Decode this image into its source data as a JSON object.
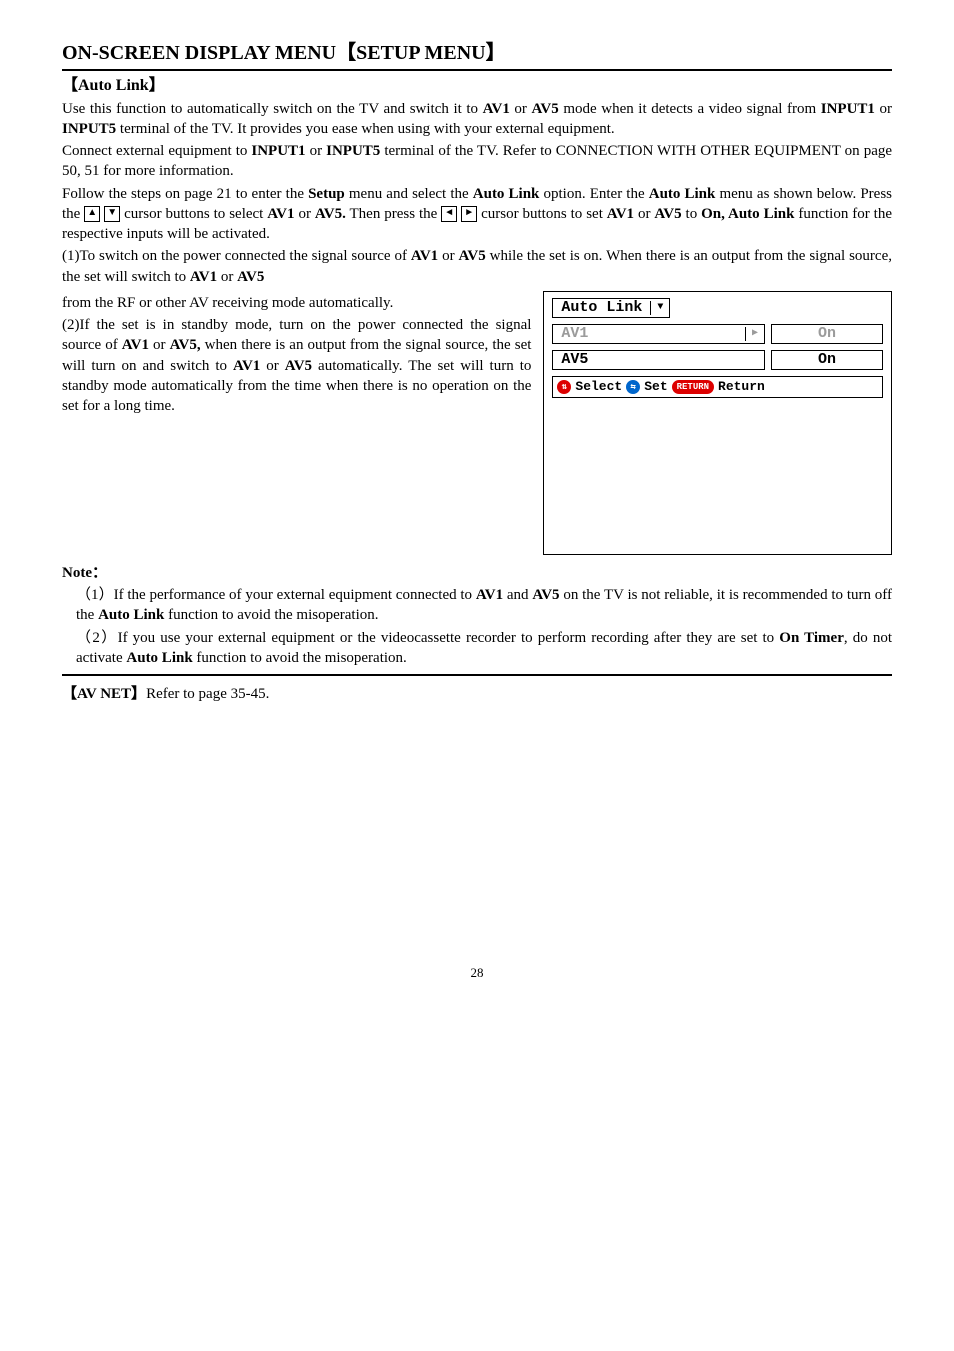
{
  "mainTitle": "ON-SCREEN DISPLAY MENU【SETUP MENU】",
  "autoLink": {
    "heading": "【Auto Link】",
    "p1a": "Use this function to automatically switch on the TV and switch it to ",
    "p1b": " or ",
    "p1c": " mode when it detects a video signal from ",
    "p1d": " or ",
    "p1e": " terminal of the TV. It provides you ease when using with your external equipment.",
    "av1": "AV1",
    "av5": "AV5",
    "input1": "INPUT1",
    "input5": "INPUT5",
    "p2a": "Connect external equipment to ",
    "p2b": " or ",
    "p2c": " terminal of the TV. Refer to CONNECTION WITH OTHER EQUIPMENT on page 50, 51 for more information.",
    "p3a": "Follow the steps on page 21 to enter the ",
    "setup": "Setup",
    "p3b": " menu and select the ",
    "autolinkB": "Auto Link",
    "p3c": " option. Enter the ",
    "p3d": " menu as shown below. Press the ",
    "p3e": " cursor buttons to select ",
    "p3f": " or ",
    "av5dot": "AV5.",
    "p3g": " Then press the ",
    "p3h": " cursor buttons to set ",
    "p3i": " or ",
    "p3j": " to ",
    "onAuto": "On, Auto Link",
    "p3k": " function for the respective inputs will be activated.",
    "p4a": "(1)To switch on the power connected the signal source of ",
    "p4b": " or ",
    "p4c": " while the set is on. When there is an output from the signal source, the set will switch to ",
    "p4d": " or ",
    "p4e": " from the RF or other AV receiving mode automatically.",
    "p5a": "(2)If the set is in standby mode, turn on the power connected the signal source of ",
    "p5b": " or ",
    "av5comma": "AV5,",
    "p5c": " when there is an output from the signal source, the set will turn on and switch to ",
    "p5d": " or ",
    "p5e": " automatically. The set will turn to standby mode automatically from the time when there is no operation on the set for a long time."
  },
  "osd": {
    "title": "Auto Link",
    "row1": "AV1",
    "row1val": "On",
    "row2": "AV5",
    "row2val": "On",
    "select": "Select",
    "set": "Set",
    "returnPill": "RETURN",
    "return": "Return"
  },
  "note": {
    "title": "Note：",
    "n1a": "（1）If the performance of your external equipment connected to ",
    "n1b": " and ",
    "n1c": " on the TV is not reliable, it is recommended to turn off the ",
    "n1d": " function to avoid the misoperation.",
    "n2a": "（2）If you use your external equipment or the videocassette recorder to perform recording after they are set to ",
    "onTimer": "On Timer",
    "n2b": ", do not activate ",
    "n2c": " function to avoid the misoperation."
  },
  "avnet": {
    "label": "【AV NET】",
    "text": "Refer to page 35-45."
  },
  "pageNum": "28"
}
